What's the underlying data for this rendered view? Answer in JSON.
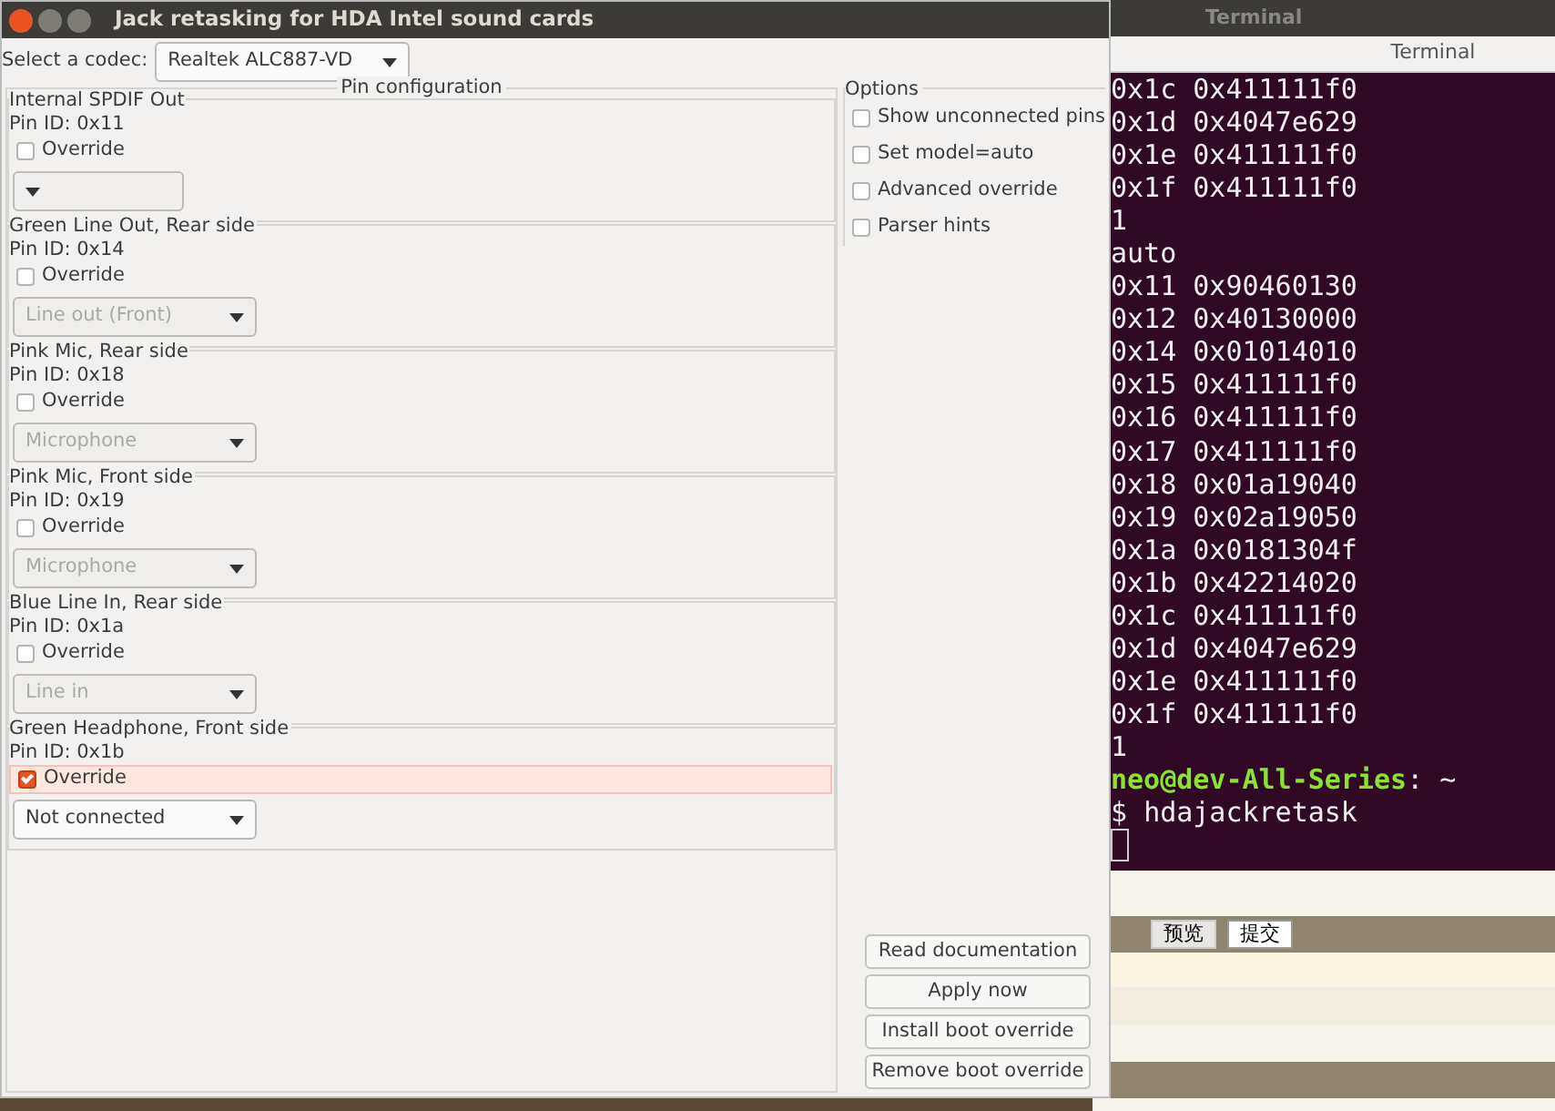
{
  "window": {
    "title": "Jack retasking for HDA Intel sound cards"
  },
  "codec": {
    "label": "Select a codec:",
    "value": "Realtek ALC887-VD"
  },
  "pin_configuration": {
    "title": "Pin configuration",
    "pins": [
      {
        "name": "Internal SPDIF Out",
        "pin_id": "Pin ID: 0x11",
        "override": {
          "label": "Override",
          "checked": false,
          "focused": false
        },
        "dropdown": {
          "disabled": true
        }
      },
      {
        "name": "Green Line Out, Rear side",
        "pin_id": "Pin ID: 0x14",
        "override": {
          "label": "Override",
          "checked": false,
          "focused": false
        },
        "dropdown": {
          "value": "Line out (Front)",
          "disabled": true
        }
      },
      {
        "name": "Pink Mic, Rear side",
        "pin_id": "Pin ID: 0x18",
        "override": {
          "label": "Override",
          "checked": false,
          "focused": false
        },
        "dropdown": {
          "value": "Microphone",
          "disabled": true
        }
      },
      {
        "name": "Pink Mic, Front side",
        "pin_id": "Pin ID: 0x19",
        "override": {
          "label": "Override",
          "checked": false,
          "focused": false
        },
        "dropdown": {
          "value": "Microphone",
          "disabled": true
        }
      },
      {
        "name": "Blue Line In, Rear side",
        "pin_id": "Pin ID: 0x1a",
        "override": {
          "label": "Override",
          "checked": false,
          "focused": false
        },
        "dropdown": {
          "value": "Line in",
          "disabled": true
        }
      },
      {
        "name": "Green Headphone, Front side",
        "pin_id": "Pin ID: 0x1b",
        "override": {
          "label": "Override",
          "checked": true,
          "focused": true
        },
        "dropdown": {
          "value": "Not connected",
          "disabled": false
        }
      }
    ]
  },
  "options": {
    "title": "Options",
    "items": [
      {
        "label": "Show unconnected pins",
        "checked": false
      },
      {
        "label": "Set model=auto",
        "checked": false
      },
      {
        "label": "Advanced override",
        "checked": false
      },
      {
        "label": "Parser hints",
        "checked": false
      }
    ]
  },
  "buttons": [
    "Read documentation",
    "Apply now",
    "Install boot override",
    "Remove boot override"
  ],
  "terminal": {
    "title": "Terminal",
    "tab": "Terminal",
    "lines": [
      "0x1c 0x411111f0",
      "0x1d 0x4047e629",
      "0x1e 0x411111f0",
      "0x1f 0x411111f0",
      "1",
      "auto",
      "0x11 0x90460130",
      "0x12 0x40130000",
      "0x14 0x01014010",
      "0x15 0x411111f0",
      "0x16 0x411111f0",
      "0x17 0x411111f0",
      "0x18 0x01a19040",
      "0x19 0x02a19050",
      "0x1a 0x0181304f",
      "0x1b 0x42214020",
      "0x1c 0x411111f0",
      "0x1d 0x4047e629",
      "0x1e 0x411111f0",
      "0x1f 0x411111f0",
      "1"
    ],
    "prompt": {
      "user_host": "neo@dev-All-Series",
      "separator": ":",
      "path": "~"
    },
    "command": {
      "symbol": "$",
      "text": "hdajackretask"
    }
  },
  "background_page": {
    "buttons": [
      {
        "label": "预览",
        "selected": true
      },
      {
        "label": "提交",
        "selected": false
      }
    ]
  }
}
